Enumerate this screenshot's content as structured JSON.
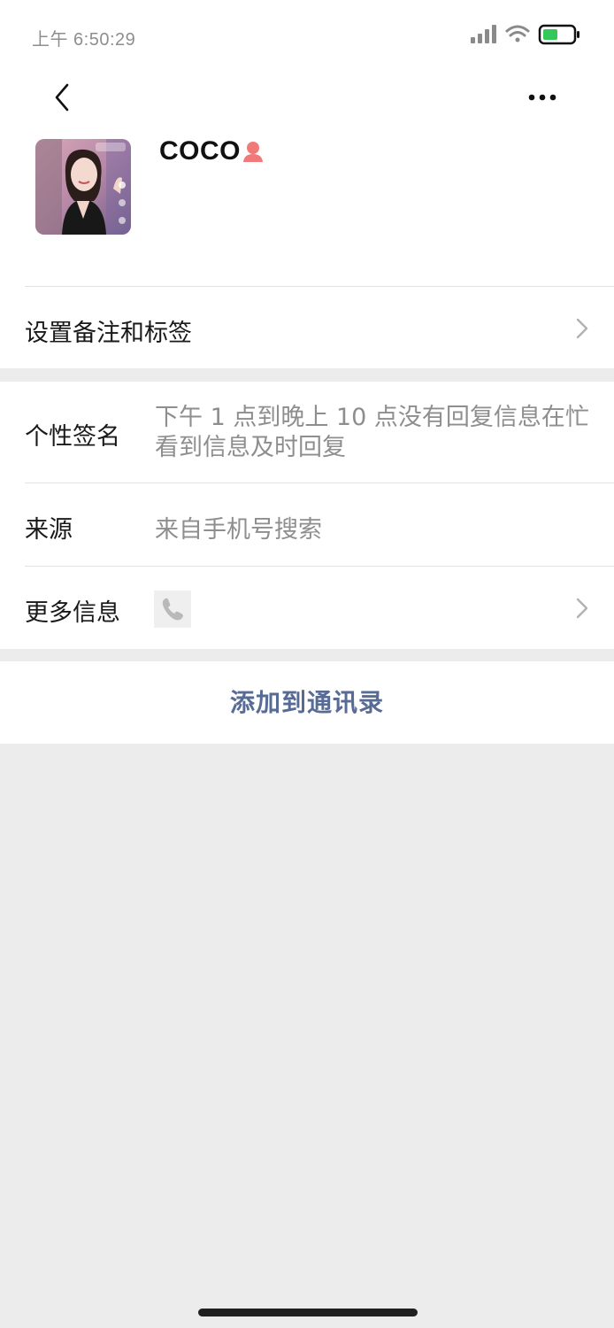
{
  "status_bar": {
    "time": "上午 6:50:29",
    "battery_color": "#34c759"
  },
  "nav": {
    "back_icon": "chevron-left-icon",
    "more_icon": "more-dots-icon"
  },
  "profile": {
    "nickname": "COCO",
    "gender_icon": "female-person-icon",
    "gender_color": "#f07a7a"
  },
  "remark_row": {
    "label": "设置备注和标签"
  },
  "info": {
    "signature_label": "个性签名",
    "signature_value": "下午 1 点到晚上 10 点没有回复信息在忙看到信息及时回复",
    "source_label": "来源",
    "source_value": "来自手机号搜索",
    "more_label": "更多信息",
    "more_icon": "phone-icon"
  },
  "actions": {
    "add_contact": "添加到通讯录",
    "accent_color": "#576b95"
  }
}
